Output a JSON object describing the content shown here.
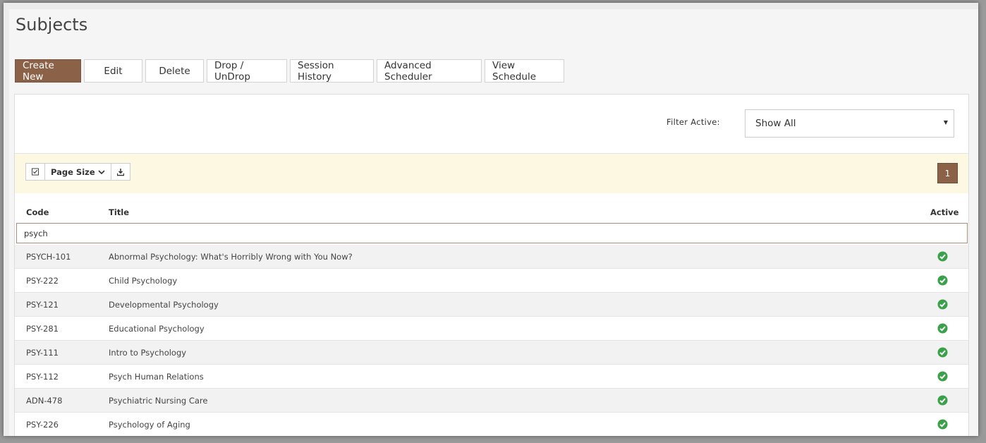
{
  "page": {
    "title": "Subjects"
  },
  "toolbar": {
    "buttons": [
      "Create New",
      "Edit",
      "Delete",
      "Drop / UnDrop",
      "Session History",
      "Advanced Scheduler",
      "View Schedule"
    ]
  },
  "filter": {
    "label": "Filter Active:",
    "selected": "Show All"
  },
  "grid_toolbar": {
    "page_size_label": "Page Size",
    "current_page": "1"
  },
  "table": {
    "columns": {
      "code": "Code",
      "title": "Title",
      "active": "Active"
    },
    "search_value": "psych",
    "rows": [
      {
        "code": "PSYCH-101",
        "title": "Abnormal Psychology: What's Horribly Wrong with You Now?",
        "active": true
      },
      {
        "code": "PSY-222",
        "title": "Child Psychology",
        "active": true
      },
      {
        "code": "PSY-121",
        "title": "Developmental Psychology",
        "active": true
      },
      {
        "code": "PSY-281",
        "title": "Educational Psychology",
        "active": true
      },
      {
        "code": "PSY-111",
        "title": "Intro to Psychology",
        "active": true
      },
      {
        "code": "PSY-112",
        "title": "Psych Human Relations",
        "active": true
      },
      {
        "code": "ADN-478",
        "title": "Psychiatric Nursing Care",
        "active": true
      },
      {
        "code": "PSY-226",
        "title": "Psychology of Aging",
        "active": true
      }
    ]
  },
  "colors": {
    "accent": "#8b6147",
    "active_check": "#3aa14a",
    "toolbar_bg": "#fdf8e1"
  },
  "icons": {
    "checkbox": "checkbox-icon",
    "chevron": "chevron-down-icon",
    "download": "download-icon",
    "active": "check-circle-icon"
  }
}
